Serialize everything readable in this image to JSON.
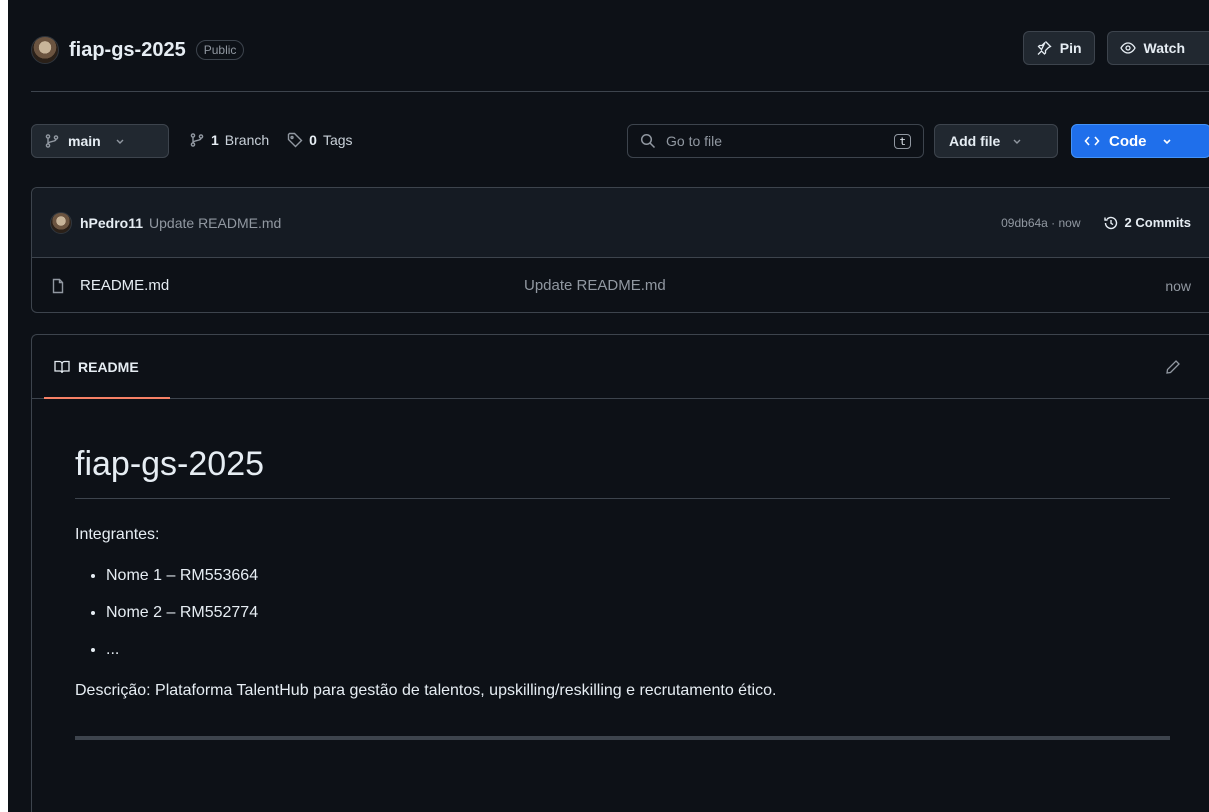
{
  "repo": {
    "name": "fiap-gs-2025",
    "visibility": "Public",
    "actions": {
      "pin": "Pin",
      "watch": "Watch"
    }
  },
  "toolbar": {
    "branch": "main",
    "branch_count": "1",
    "branch_label": "Branch",
    "tag_count": "0",
    "tag_label": "Tags",
    "goto_placeholder": "Go to file",
    "goto_shortcut": "t",
    "add_file": "Add file",
    "code": "Code"
  },
  "latest_commit": {
    "author": "hPedro11",
    "message": "Update README.md",
    "hash_time": "09db64a · now",
    "commits_label": "2 Commits"
  },
  "files": [
    {
      "name": "README.md",
      "message": "Update README.md",
      "time": "now"
    }
  ],
  "readme": {
    "tab_label": "README",
    "title": "fiap-gs-2025",
    "intro": "Integrantes:",
    "members": [
      "Nome 1 – RM553664",
      "Nome 2 – RM552774",
      "..."
    ],
    "description": "Descrição: Plataforma TalentHub para gestão de talentos, upskilling/reskilling e recrutamento ético."
  },
  "colors": {
    "background": "#0d1117",
    "code_button": "#1f6feb",
    "active_tab_underline": "#f78166"
  }
}
